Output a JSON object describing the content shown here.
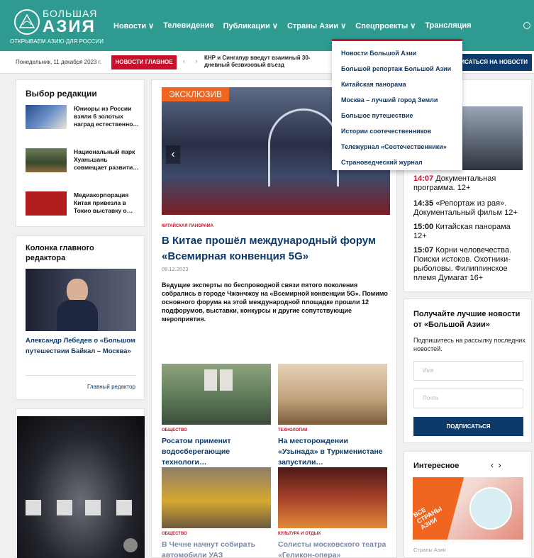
{
  "header": {
    "logo_line1": "БОЛЬШАЯ",
    "logo_line2": "АЗИЯ",
    "logo_sub": "ОТКРЫВАЕМ АЗИЮ ДЛЯ РОССИИ",
    "nav": [
      "Новости ∨",
      "Телевидение",
      "Публикации ∨",
      "Страны Азии ∨",
      "Спецпроекты ∨",
      "Трансляция"
    ]
  },
  "ticker": {
    "date": "Понедельник, 11 декабря 2023 г.",
    "badge": "НОВОСТИ ГЛАВНОЕ",
    "arrows": "‹ ›",
    "text": "КНР и Сингапур введут взаимный 30-дневный безвизовый въезд",
    "subscribe": "ИСАТЬСЯ НА НОВОСТИ"
  },
  "dropdown": [
    "Новости Большой Азии",
    "Большой репортаж Большой Азии",
    "Китайская панорама",
    "Москва – лучший город Земли",
    "Большое путешествие",
    "Истории соотечественников",
    "Тележурнал «Соотечественники»",
    "Страноведческий журнал"
  ],
  "editors_choice": {
    "title": "Выбор редакции",
    "items": [
      "Юниоры из России взяли 6 золотых наград естественно…",
      "Национальный парк Хуаньшань совмещает развити…",
      "Медиакорпорация Китая привезла в Токио выставку о…"
    ]
  },
  "chief_column": {
    "title": "Колонка главного редактора",
    "article": "Александр Лебедев о «Большом путешествии Байкал – Москва»",
    "role": "Главный редактор"
  },
  "main": {
    "exclusive": "ЭКСКЛЮЗИВ",
    "category": "КИТАЙСКАЯ ПАНОРАМА",
    "title": "В Китае прошёл международный форум «Всемирная конвенция 5G»",
    "date": "09.12.2023",
    "lead": "Ведущие эксперты по беспроводной связи пятого поколения собрались в городе Чжэнчжоу на «Всемирной конвенции 5G». Помимо основного форума на этой международной площадке прошли 12 подфорумов, выставки, конкурсы и другие сопутствующие мероприятия.",
    "news": [
      {
        "cat": "ОБЩЕСТВО",
        "title": "Росатом применит водосберегающие технологи…"
      },
      {
        "cat": "ТЕХНОЛОГИИ",
        "title": "На месторождении «Узынада» в Туркменистане запустили…"
      },
      {
        "cat": "ОБЩЕСТВО",
        "title": "В Чечне начнут собирать автомобили УАЗ"
      },
      {
        "cat": "КУЛЬТУРА И ОТДЫХ",
        "title": "Солисты московского театра «Геликон-опера» исполнили…"
      }
    ]
  },
  "tv": {
    "title_tail": "о",
    "schedule": [
      {
        "time": "14:07",
        "text": "Документальная программа. 12+"
      },
      {
        "time": "14:35",
        "text": "«Репортаж из рая». Документальный фильм 12+"
      },
      {
        "time": "15:00",
        "text": "Китайская панорама 12+"
      },
      {
        "time": "15:07",
        "text": "Корни человечества. Поиски истоков. Охотники-рыболовы. Филиппинское племя Думагат 16+"
      }
    ]
  },
  "newsletter": {
    "title": "Получайте лучшие новости от «Большой Азии»",
    "text": "Подпишитесь на рассылку последних новостей.",
    "name_placeholder": "Имя",
    "mail_placeholder": "Почта",
    "button": "ПОДПИСАТЬСЯ"
  },
  "interesting": {
    "title": "Интересное",
    "arrows": "‹  ›",
    "banner": "ВСЕ СТРАНЫ АЗИИ",
    "caption": "Страны Азии"
  },
  "colors": {
    "header": "#2e9a90",
    "accent": "#c9102a",
    "navy": "#0c3a6a",
    "exclusive": "#f0651f"
  }
}
